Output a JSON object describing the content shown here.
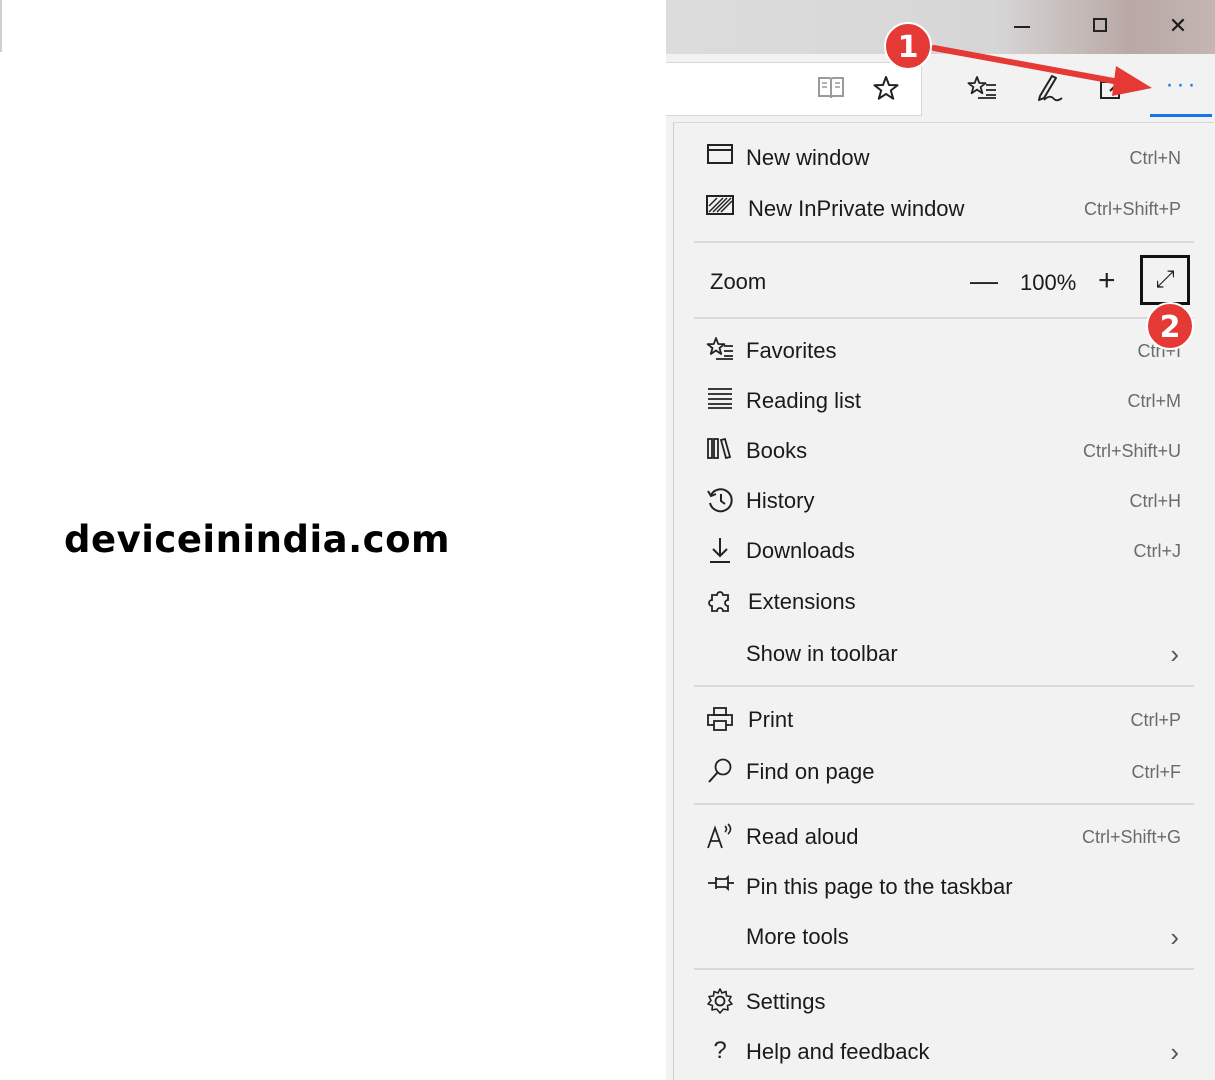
{
  "watermark": "deviceinindia.com",
  "window_controls": {
    "minimize": "—",
    "maximize": "",
    "close": "✕"
  },
  "toolbar": {
    "reading_view_icon": "book-icon",
    "favorite_star_icon": "star-icon",
    "favorites_hub_icon": "favorites-list-icon",
    "pen_icon": "pen-icon",
    "share_icon": "share-icon",
    "more_label": "···"
  },
  "callouts": {
    "one": "1",
    "two": "2"
  },
  "menu": {
    "new_window": {
      "label": "New window",
      "shortcut": "Ctrl+N"
    },
    "new_inprivate": {
      "label": "New InPrivate window",
      "shortcut": "Ctrl+Shift+P"
    },
    "zoom": {
      "label": "Zoom",
      "minus": "—",
      "value": "100%",
      "plus": "+",
      "fullscreen": "⤢"
    },
    "favorites": {
      "label": "Favorites",
      "shortcut": "Ctrl+I"
    },
    "reading_list": {
      "label": "Reading list",
      "shortcut": "Ctrl+M"
    },
    "books": {
      "label": "Books",
      "shortcut": "Ctrl+Shift+U"
    },
    "history": {
      "label": "History",
      "shortcut": "Ctrl+H"
    },
    "downloads": {
      "label": "Downloads",
      "shortcut": "Ctrl+J"
    },
    "extensions": {
      "label": "Extensions"
    },
    "show_in_toolbar": {
      "label": "Show in toolbar",
      "chevron": "›"
    },
    "print": {
      "label": "Print",
      "shortcut": "Ctrl+P"
    },
    "find_on_page": {
      "label": "Find on page",
      "shortcut": "Ctrl+F"
    },
    "read_aloud": {
      "label": "Read aloud",
      "shortcut": "Ctrl+Shift+G"
    },
    "pin_taskbar": {
      "label": "Pin this page to the taskbar"
    },
    "more_tools": {
      "label": "More tools",
      "chevron": "›"
    },
    "settings": {
      "label": "Settings"
    },
    "help_feedback": {
      "label": "Help and feedback",
      "chevron": "›"
    }
  },
  "colors": {
    "accent": "#1a73e8",
    "callout": "#e53935",
    "menu_bg": "#f2f2f2"
  }
}
